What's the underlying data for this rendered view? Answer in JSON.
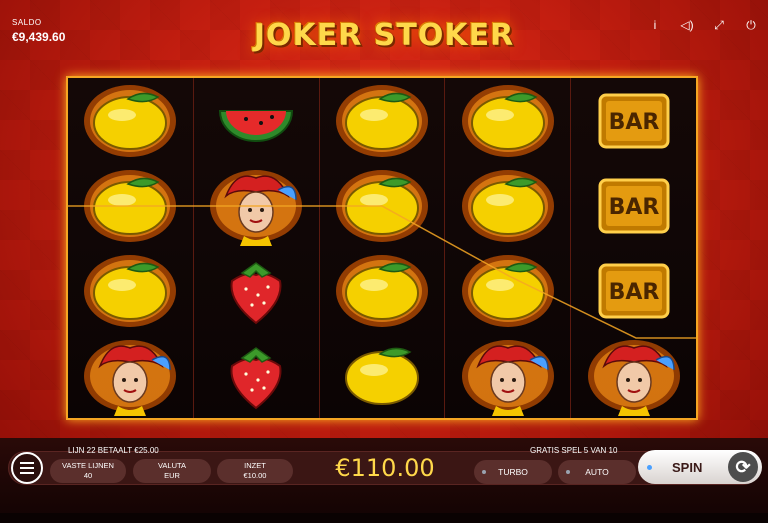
{
  "balance": {
    "label": "SALDO",
    "value": "€9,439.60"
  },
  "game": {
    "title": "JOKER STOKER"
  },
  "top_icons": [
    "info-icon",
    "sound-icon",
    "fullscreen-icon",
    "power-icon"
  ],
  "reels": [
    [
      "lemon-fire",
      "lemon-fire",
      "lemon-fire",
      "joker-fire"
    ],
    [
      "watermelon",
      "joker-fire",
      "strawberry",
      "strawberry"
    ],
    [
      "lemon-fire",
      "lemon-fire",
      "lemon-fire",
      "lemon"
    ],
    [
      "lemon-fire",
      "lemon-fire",
      "lemon-fire",
      "joker-fire"
    ],
    [
      "bar",
      "bar",
      "bar",
      "joker-fire"
    ]
  ],
  "symbols": {
    "bar_text": "BAR"
  },
  "win_info": {
    "left": "LIJN 22 BETAALT €25.00",
    "right": "GRATIS SPEL 5 VAN 10"
  },
  "controls": {
    "lines": {
      "label": "VASTE LIJNEN",
      "value": "40"
    },
    "currency": {
      "label": "VALUTA",
      "value": "EUR"
    },
    "stake": {
      "label": "INZET",
      "value": "€10.00"
    },
    "bet_amount": "€110.00",
    "turbo": "TURBO",
    "auto": "AUTO",
    "spin": "SPIN"
  },
  "colors": {
    "accent_gold": "#ffd84a",
    "frame": "#f5a623",
    "background": "#c41e10"
  }
}
